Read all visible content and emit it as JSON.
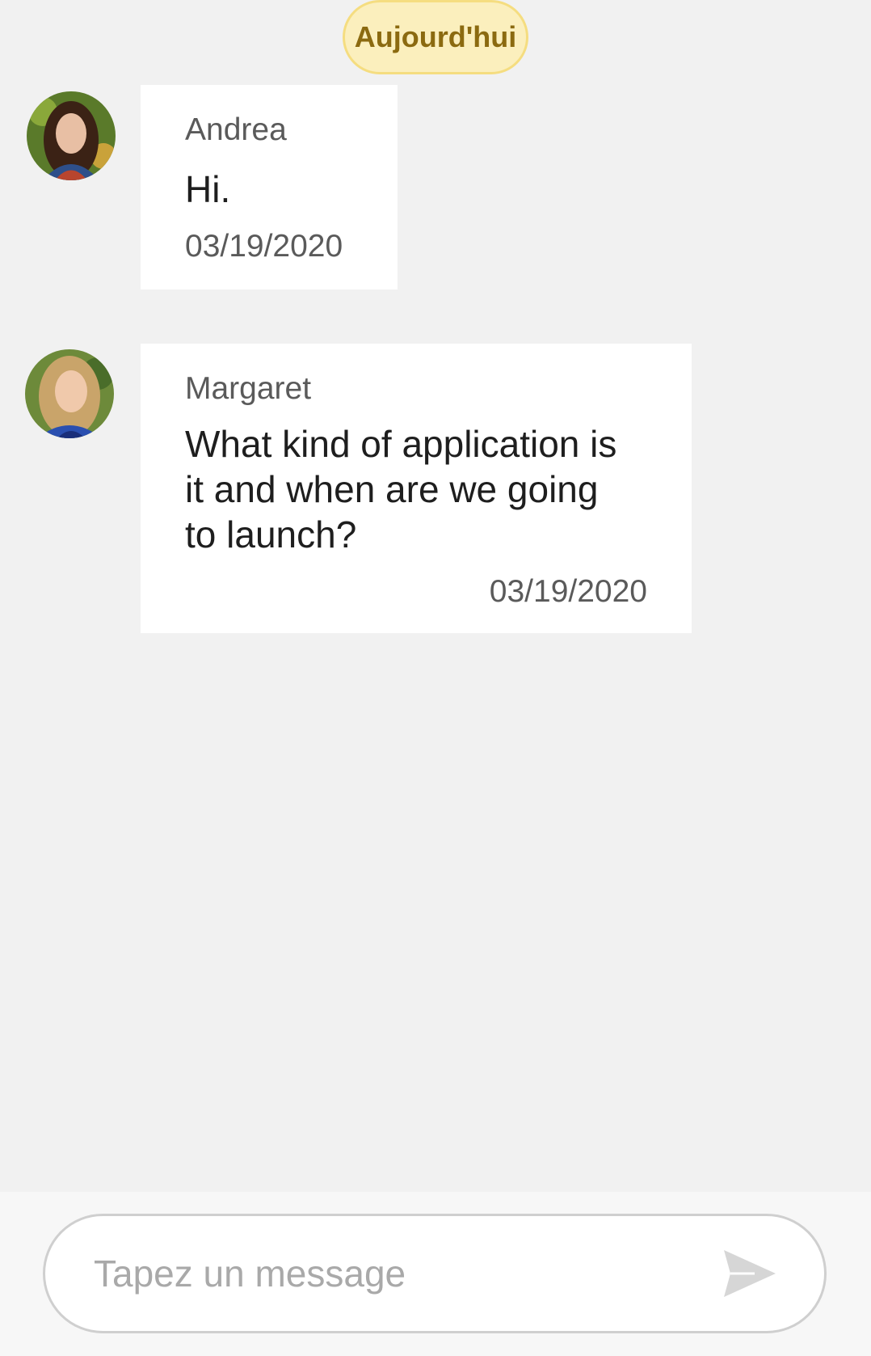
{
  "chat": {
    "date_separator": "Aujourd'hui",
    "messages": [
      {
        "sender": "Andrea",
        "text": "Hi.",
        "date": "03/19/2020"
      },
      {
        "sender": "Margaret",
        "text_lines": [
          "What kind of application is",
          "it and when are we going",
          "to launch?"
        ],
        "date": "03/19/2020"
      }
    ]
  },
  "composer": {
    "placeholder": "Tapez un message"
  },
  "icons": {
    "send": "send-icon"
  },
  "colors": {
    "background": "#f1f1f1",
    "date_pill_bg": "#fbefbd",
    "date_pill_border": "#f5dd80",
    "date_pill_text": "#8b6a10",
    "bubble_bg": "#ffffff",
    "send_icon": "#d6d6d6"
  }
}
